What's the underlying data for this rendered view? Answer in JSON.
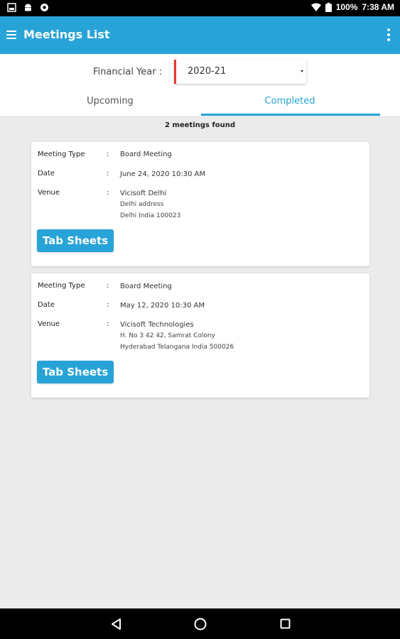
{
  "status_bar": {
    "battery": "100%",
    "time": "7:38 AM",
    "icons": [
      "screenshot-icon",
      "android-icon",
      "settings-icon",
      "wifi-icon",
      "battery-icon"
    ]
  },
  "app_bar": {
    "title": "Meetings List",
    "color": "#27a3d7",
    "icons": [
      "menu-icon",
      "more-vert-icon"
    ]
  },
  "filter": {
    "label": "Financial Year :",
    "selected_year": "2020-21"
  },
  "tabs": [
    {
      "label": "Upcoming",
      "active": false
    },
    {
      "label": "Completed",
      "active": true
    }
  ],
  "results_count": "2 meetings found",
  "meetings": [
    {
      "type_label": "Meeting Type",
      "type_value": "Board Meeting",
      "date_label": "Date",
      "date_value": "June 24, 2020 10:30 AM",
      "venue_label": "Venue",
      "venue_name": "Vicisoft Delhi",
      "venue_line1": "Delhi address",
      "venue_line2": "Delhi India 100023",
      "button_label": "Tab Sheets"
    },
    {
      "type_label": "Meeting Type",
      "type_value": "Board Meeting",
      "date_label": "Date",
      "date_value": "May 12, 2020 10:30 AM",
      "venue_label": "Venue",
      "venue_name": "Vicisoft Technologies",
      "venue_line1": "H. No 3 42 42, Samrat Colony",
      "venue_line2": "Hyderabad Telangana India 500026",
      "button_label": "Tab Sheets"
    }
  ],
  "colon": ":",
  "nav_bar": {
    "icons": [
      "back-icon",
      "home-icon",
      "recents-icon"
    ]
  }
}
